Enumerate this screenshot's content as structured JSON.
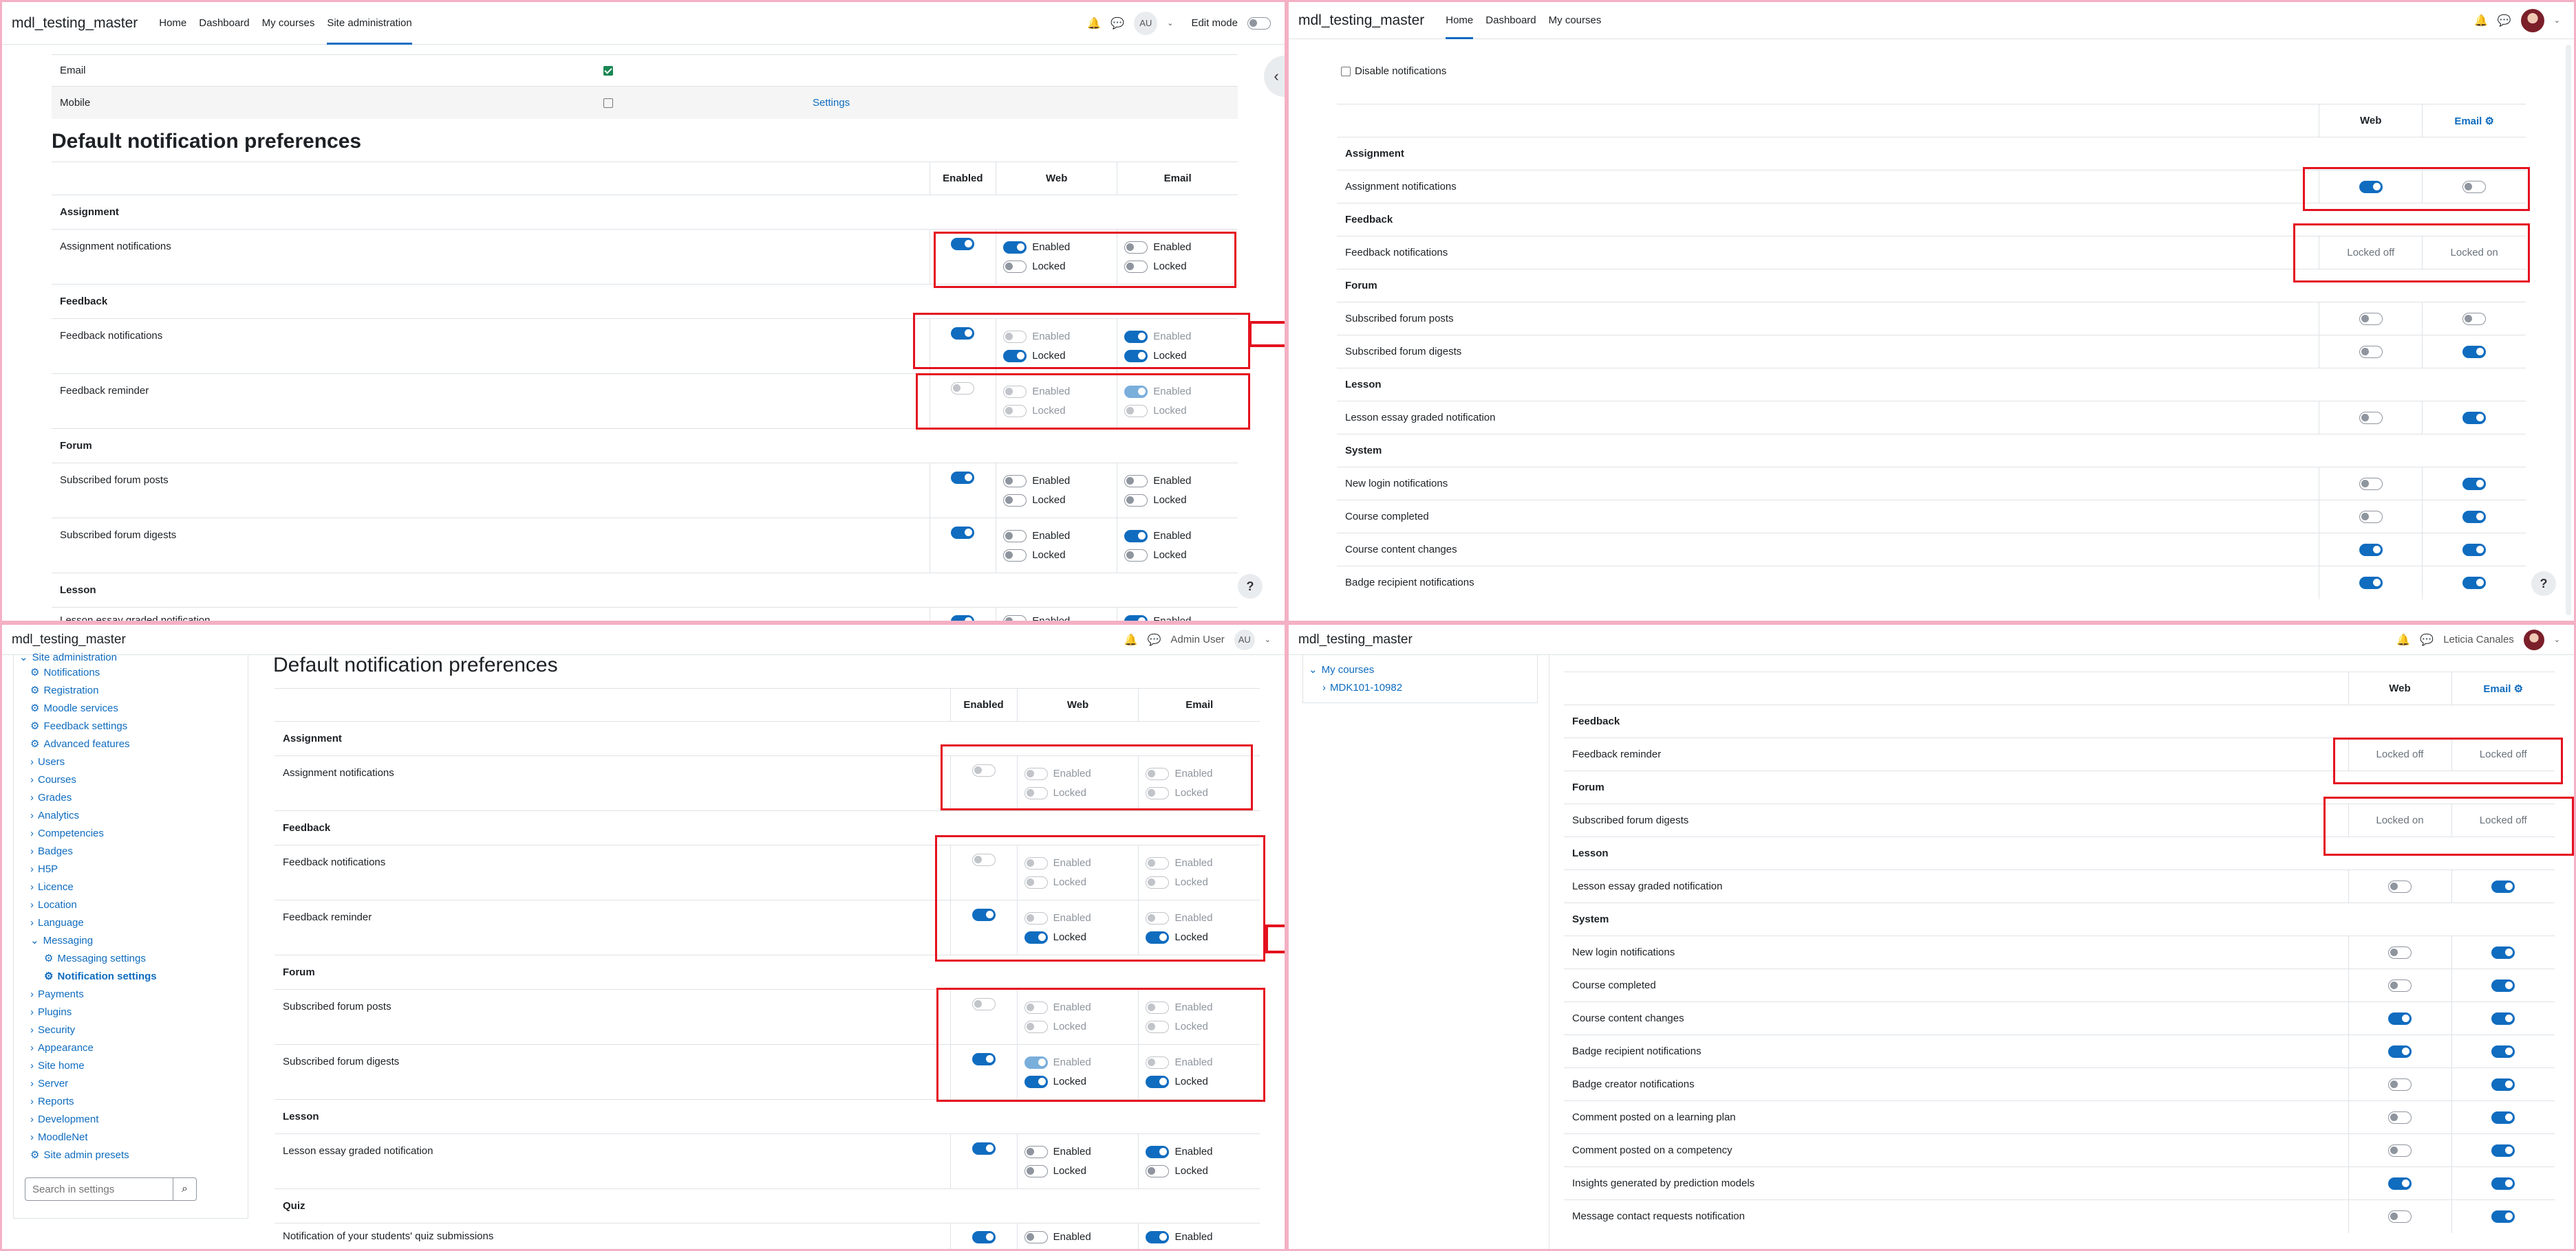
{
  "q1": {
    "brand": "mdl_testing_master",
    "nav": [
      "Home",
      "Dashboard",
      "My courses",
      "Site administration"
    ],
    "avatar": "AU",
    "edit_mode": "Edit mode",
    "email_label": "Email",
    "mobile_label": "Mobile",
    "settings_link": "Settings",
    "heading": "Default notification preferences",
    "cols": [
      "Enabled",
      "Web",
      "Email"
    ],
    "enabled_word": "Enabled",
    "locked_word": "Locked",
    "sections": {
      "assignment": "Assignment",
      "feedback": "Feedback",
      "forum": "Forum",
      "lesson": "Lesson"
    },
    "rows": {
      "assignment_notifications": "Assignment notifications",
      "feedback_notifications": "Feedback notifications",
      "feedback_reminder": "Feedback reminder",
      "subscribed_forum_posts": "Subscribed forum posts",
      "subscribed_forum_digests": "Subscribed forum digests",
      "lesson_essay": "Lesson essay graded notification"
    },
    "help": "?"
  },
  "q2": {
    "brand": "mdl_testing_master",
    "nav": [
      "Home",
      "Dashboard",
      "My courses"
    ],
    "disable_notifications": "Disable notifications",
    "cols": [
      "Web",
      "Email"
    ],
    "locked_off": "Locked off",
    "locked_on": "Locked on",
    "sections": {
      "assignment": "Assignment",
      "feedback": "Feedback",
      "forum": "Forum",
      "lesson": "Lesson",
      "system": "System"
    },
    "rows": {
      "assignment_notifications": "Assignment notifications",
      "feedback_notifications": "Feedback notifications",
      "subscribed_forum_posts": "Subscribed forum posts",
      "subscribed_forum_digests": "Subscribed forum digests",
      "lesson_essay": "Lesson essay graded notification",
      "new_login": "New login notifications",
      "course_completed": "Course completed",
      "course_content_changes": "Course content changes",
      "badge_recipient": "Badge recipient notifications"
    },
    "help": "?"
  },
  "q3": {
    "brand": "mdl_testing_master",
    "user": "Admin User",
    "avatar": "AU",
    "heading": "Default notification preferences",
    "cols": [
      "Enabled",
      "Web",
      "Email"
    ],
    "enabled_word": "Enabled",
    "locked_word": "Locked",
    "sidebar": {
      "top": "Site administration",
      "items": [
        "Notifications",
        "Registration",
        "Moodle services",
        "Feedback settings",
        "Advanced features"
      ],
      "groups": [
        "Users",
        "Courses",
        "Grades",
        "Analytics",
        "Competencies",
        "Badges",
        "H5P",
        "Licence",
        "Location",
        "Language",
        "Messaging"
      ],
      "messaging_children": [
        "Messaging settings",
        "Notification settings"
      ],
      "groups_after": [
        "Payments",
        "Plugins",
        "Security",
        "Appearance",
        "Site home",
        "Server",
        "Reports",
        "Development",
        "MoodleNet"
      ],
      "presets": "Site admin presets",
      "search_placeholder": "Search in settings"
    },
    "sections": {
      "assignment": "Assignment",
      "feedback": "Feedback",
      "forum": "Forum",
      "lesson": "Lesson",
      "quiz": "Quiz"
    },
    "rows": {
      "assignment_notifications": "Assignment notifications",
      "feedback_notifications": "Feedback notifications",
      "feedback_reminder": "Feedback reminder",
      "subscribed_forum_posts": "Subscribed forum posts",
      "subscribed_forum_digests": "Subscribed forum digests",
      "lesson_essay": "Lesson essay graded notification",
      "quiz_notification": "Notification of your students' quiz submissions"
    }
  },
  "q4": {
    "brand": "mdl_testing_master",
    "user": "Leticia Canales",
    "my_courses": "My courses",
    "course": "MDK101-10982",
    "cols": [
      "Web",
      "Email"
    ],
    "locked_off": "Locked off",
    "locked_on": "Locked on",
    "sections": {
      "feedback": "Feedback",
      "forum": "Forum",
      "lesson": "Lesson",
      "system": "System"
    },
    "rows": {
      "feedback_reminder": "Feedback reminder",
      "subscribed_forum_digests": "Subscribed forum digests",
      "lesson_essay": "Lesson essay graded notification",
      "new_login": "New login notifications",
      "course_completed": "Course completed",
      "course_content_changes": "Course content changes",
      "badge_recipient": "Badge recipient notifications",
      "badge_creator": "Badge creator notifications",
      "comment_learning_plan": "Comment posted on a learning plan",
      "comment_competency": "Comment posted on a competency",
      "insights": "Insights generated by prediction models",
      "contact_requests": "Message contact requests notification"
    }
  },
  "colors": {
    "accent": "#0f6cbf",
    "highlight": "#e4111f",
    "divider": "#f4b0c4"
  }
}
